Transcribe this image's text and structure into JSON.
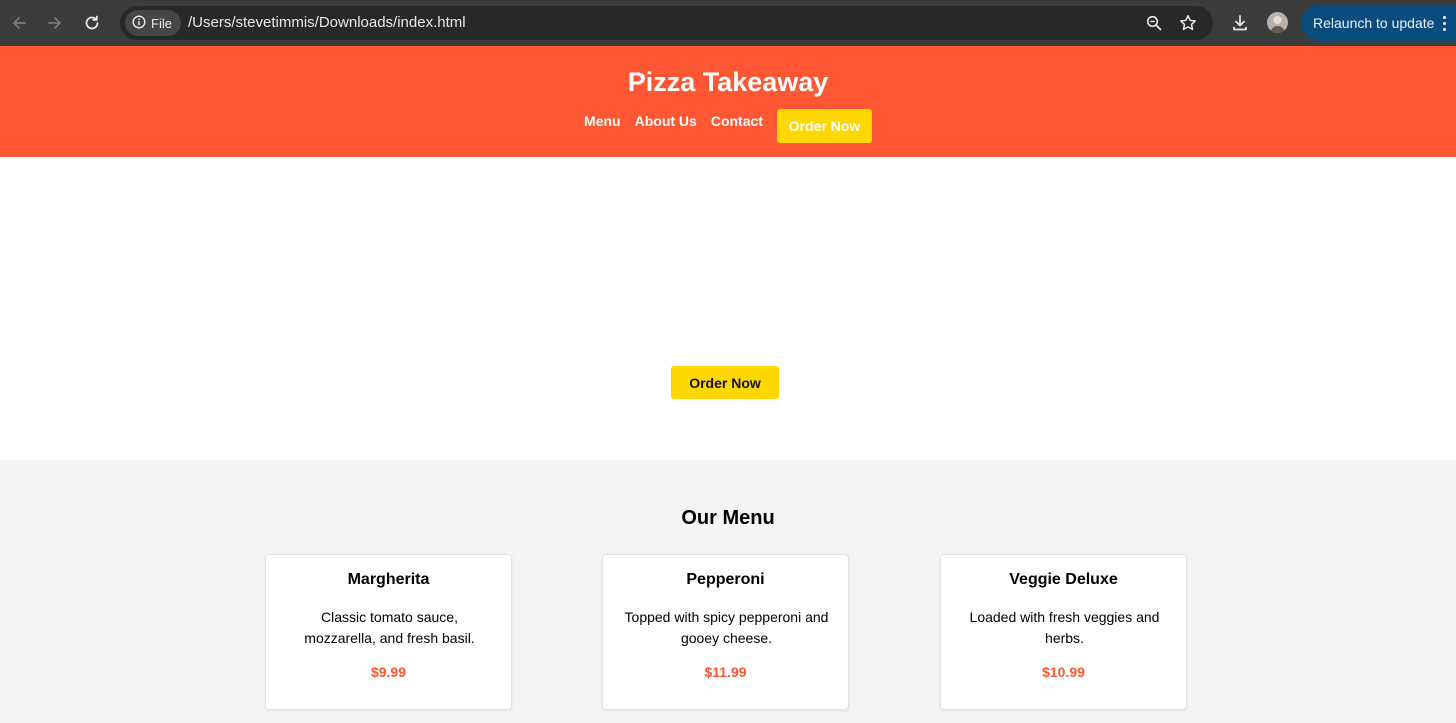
{
  "browser": {
    "chip_label": "File",
    "url": "/Users/stevetimmis/Downloads/index.html",
    "relaunch_label": "Relaunch to update",
    "icons": [
      "back-icon",
      "forward-icon",
      "reload-icon",
      "info-icon",
      "zoom-icon",
      "star-icon",
      "download-icon",
      "profile-avatar",
      "more-icon"
    ]
  },
  "header": {
    "title": "Pizza Takeaway",
    "nav": [
      {
        "label": "Menu"
      },
      {
        "label": "About Us"
      },
      {
        "label": "Contact"
      }
    ],
    "order_button": "Order Now"
  },
  "hero": {
    "order_button": "Order Now"
  },
  "menu": {
    "title": "Our Menu",
    "items": [
      {
        "name": "Margherita",
        "description": "Classic tomato sauce, mozzarella, and fresh basil.",
        "price": "$9.99"
      },
      {
        "name": "Pepperoni",
        "description": "Topped with spicy pepperoni and gooey cheese.",
        "price": "$11.99"
      },
      {
        "name": "Veggie Deluxe",
        "description": "Loaded with fresh veggies and herbs.",
        "price": "$10.99"
      }
    ]
  },
  "colors": {
    "header_bg": "#ff5733",
    "button_bg": "#ffd700",
    "price": "#ff5733",
    "section_bg": "#f4f4f4",
    "chrome_bg": "#3c3c3c",
    "relaunch_bg": "#0b4c7e"
  }
}
